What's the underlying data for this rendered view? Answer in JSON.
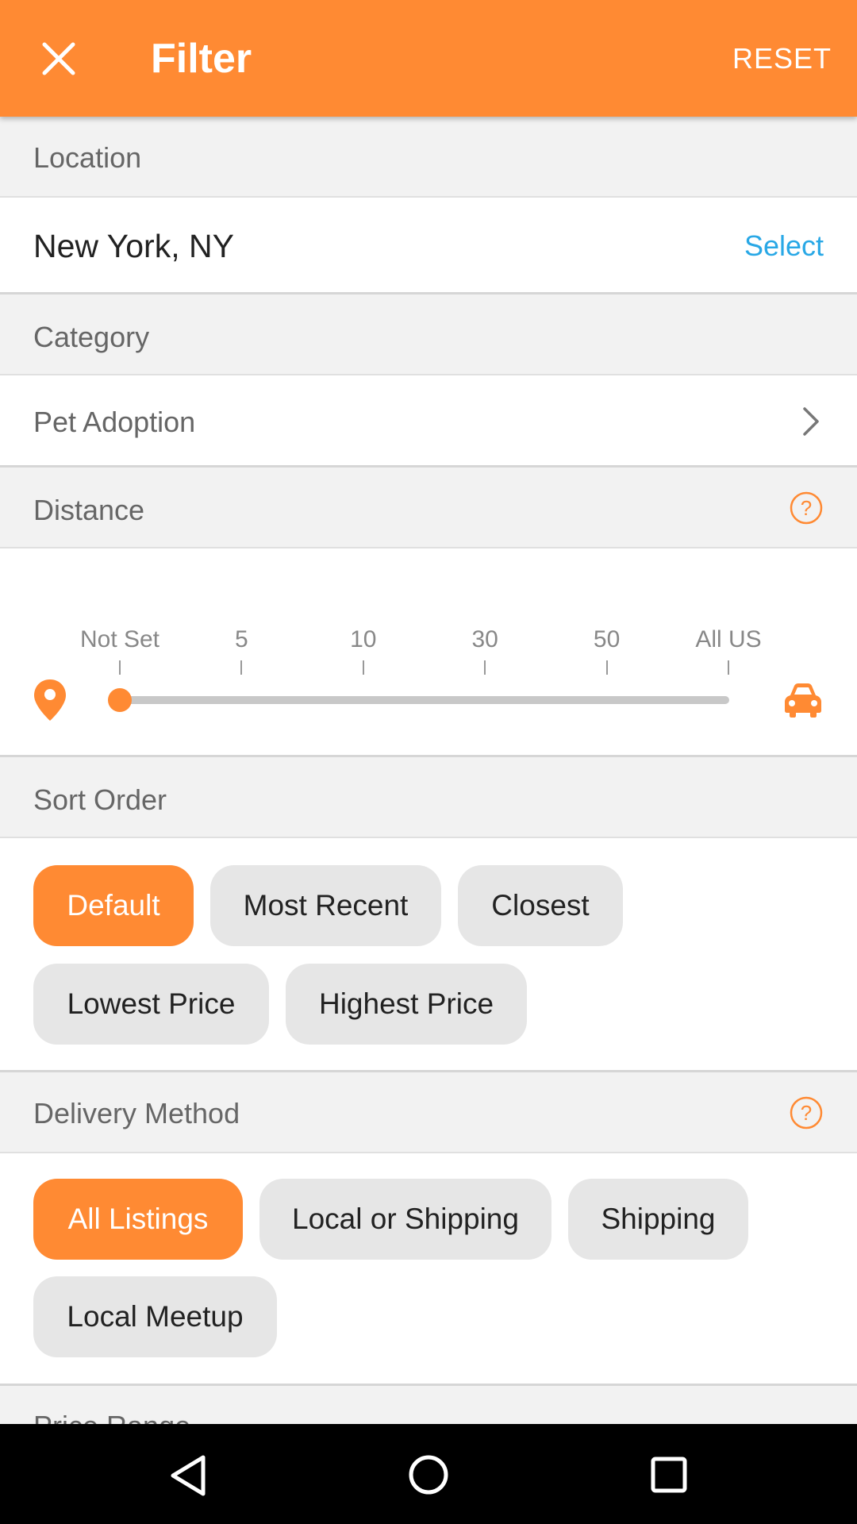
{
  "appbar": {
    "title": "Filter",
    "reset_label": "RESET"
  },
  "location": {
    "header": "Location",
    "value": "New York, NY",
    "select_label": "Select"
  },
  "category": {
    "header": "Category",
    "value": "Pet Adoption"
  },
  "distance": {
    "header": "Distance",
    "ticks": [
      "Not Set",
      "5",
      "10",
      "30",
      "50",
      "All US"
    ],
    "selected_index": 0
  },
  "sort_order": {
    "header": "Sort Order",
    "options": [
      "Default",
      "Most Recent",
      "Closest",
      "Lowest Price",
      "Highest Price"
    ],
    "selected": "Default"
  },
  "delivery": {
    "header": "Delivery Method",
    "options": [
      "All Listings",
      "Local or Shipping",
      "Shipping",
      "Local Meetup"
    ],
    "selected": "All Listings"
  },
  "price_range": {
    "header": "Price Range"
  },
  "colors": {
    "accent": "#ff8a33",
    "link": "#29a8e6"
  }
}
